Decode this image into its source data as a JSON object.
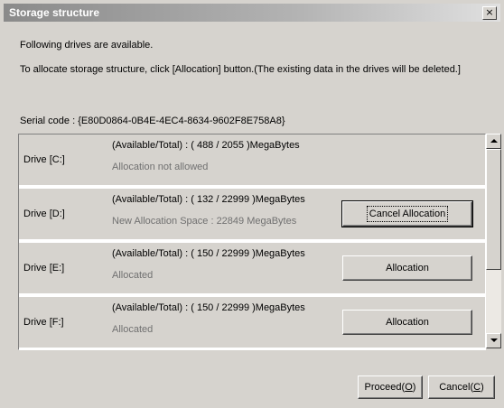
{
  "window": {
    "title": "Storage structure",
    "close_glyph": "×"
  },
  "messages": {
    "available": "Following drives are available.",
    "instruction": "To allocate storage structure, click [Allocation] button.(The existing data in the drives will be deleted.]"
  },
  "serial": {
    "text": "Serial code : {E80D0864-0B4E-4EC4-8634-9602F8E758A8}"
  },
  "drives": [
    {
      "name": "Drive [C:]",
      "space": "(Available/Total) : ( 488 / 2055 )MegaBytes",
      "status": "Allocation not allowed",
      "action": ""
    },
    {
      "name": "Drive [D:]",
      "space": "(Available/Total) : ( 132 / 22999 )MegaBytes",
      "status": "New Allocation Space : 22849 MegaBytes",
      "action": "Cancel Allocation"
    },
    {
      "name": "Drive [E:]",
      "space": "(Available/Total) : ( 150 / 22999 )MegaBytes",
      "status": "Allocated",
      "action": "Allocation"
    },
    {
      "name": "Drive [F:]",
      "space": "(Available/Total) : ( 150 / 22999 )MegaBytes",
      "status": "Allocated",
      "action": "Allocation"
    }
  ],
  "footer": {
    "proceed_label": "Proceed",
    "proceed_mnemonic": "O",
    "cancel_label": "Cancel",
    "cancel_mnemonic": "C"
  }
}
